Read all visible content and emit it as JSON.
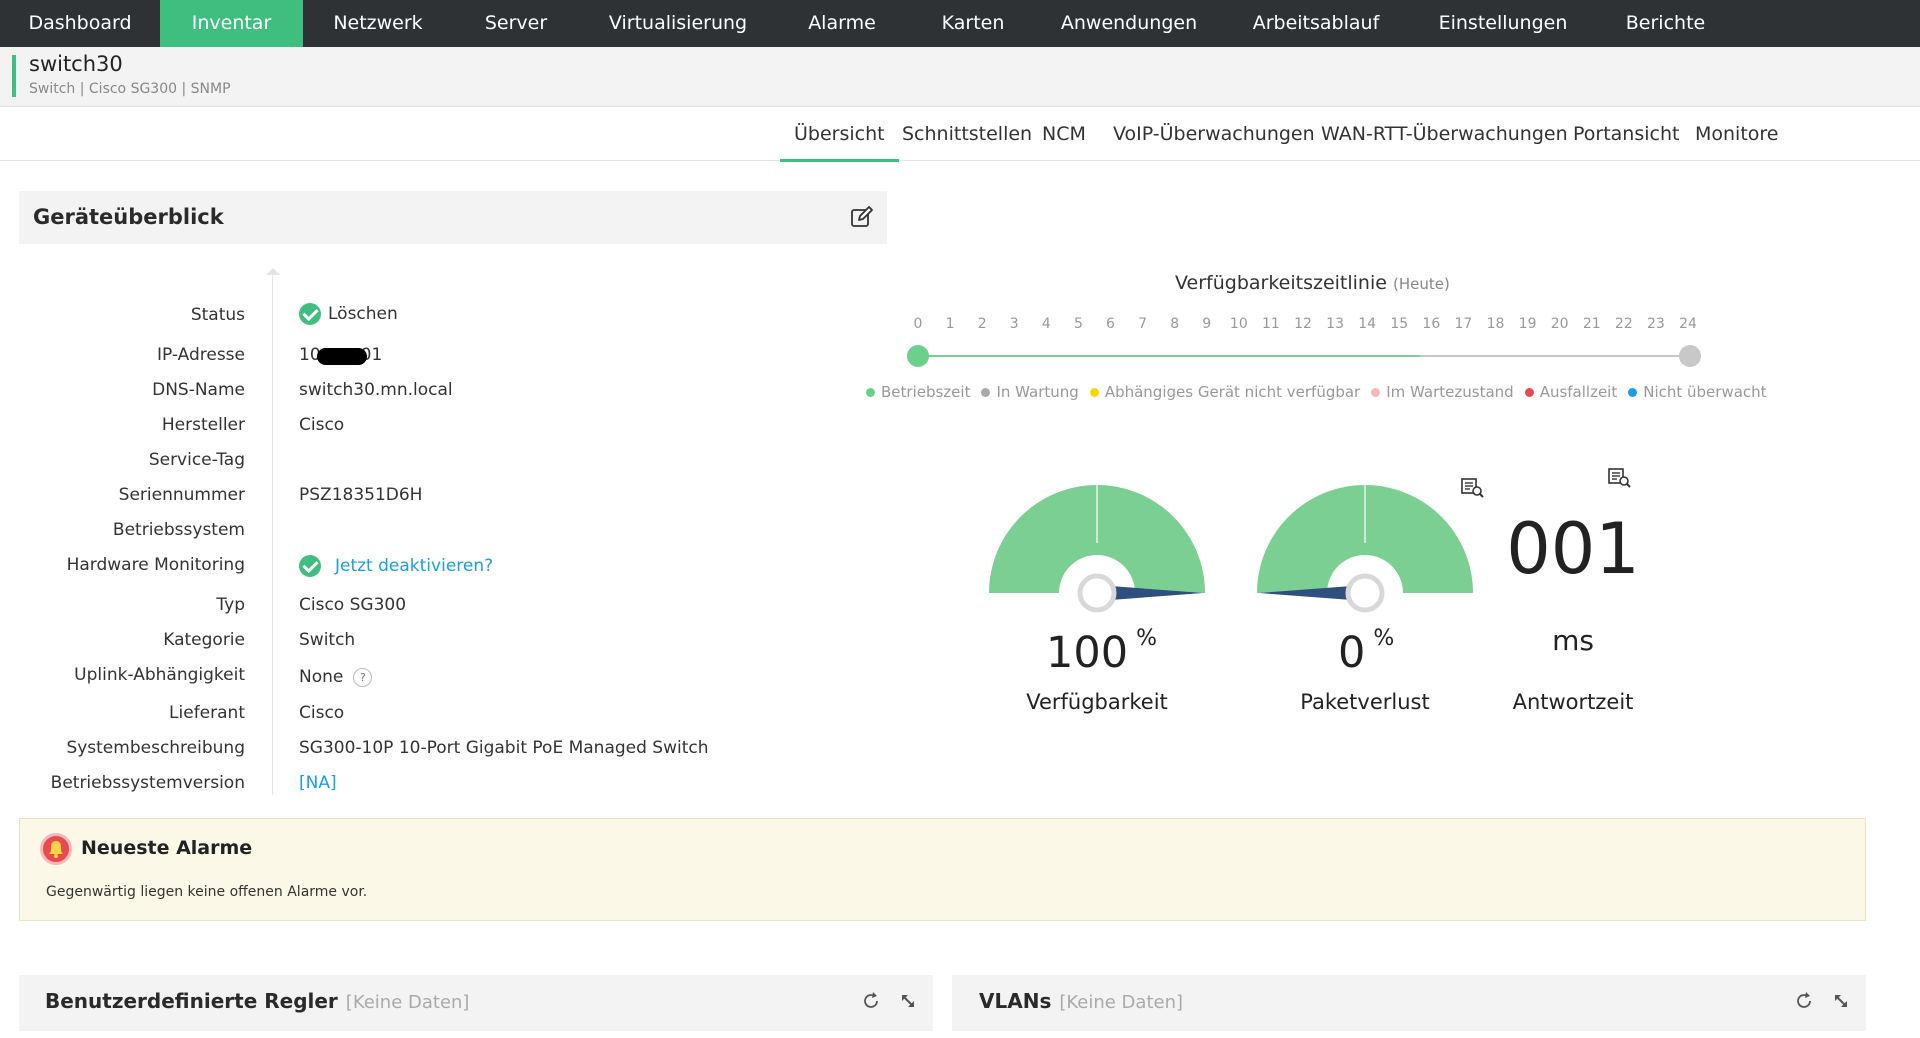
{
  "nav": {
    "items": [
      {
        "label": "Dashboard",
        "active": false
      },
      {
        "label": "Inventar",
        "active": true
      },
      {
        "label": "Netzwerk",
        "active": false
      },
      {
        "label": "Server",
        "active": false
      },
      {
        "label": "Virtualisierung",
        "active": false
      },
      {
        "label": "Alarme",
        "active": false
      },
      {
        "label": "Karten",
        "active": false
      },
      {
        "label": "Anwendungen",
        "active": false
      },
      {
        "label": "Arbeitsablauf",
        "active": false
      },
      {
        "label": "Einstellungen",
        "active": false
      },
      {
        "label": "Berichte",
        "active": false
      }
    ],
    "active_color": "#3fbf7f"
  },
  "device": {
    "name": "switch30",
    "meta": "Switch | Cisco SG300  | SNMP"
  },
  "tabs": [
    {
      "label": "Übersicht",
      "active": true
    },
    {
      "label": "Schnittstellen",
      "active": false
    },
    {
      "label": "NCM",
      "active": false
    },
    {
      "label": "VoIP-Überwachungen",
      "active": false
    },
    {
      "label": "WAN-RTT-Überwachungen",
      "active": false
    },
    {
      "label": "Portansicht",
      "active": false
    },
    {
      "label": "Monitore",
      "active": false
    }
  ],
  "overview": {
    "title": "Geräteüberblick",
    "edit_icon": "edit-icon",
    "properties": {
      "status": {
        "label": "Status",
        "value": "Löschen"
      },
      "ip": {
        "label": "IP-Adresse",
        "value_start": "10",
        "value_end": "01"
      },
      "dns": {
        "label": "DNS-Name",
        "value": "switch30.mn.local"
      },
      "manufacturer": {
        "label": "Hersteller",
        "value": "Cisco"
      },
      "service_tag": {
        "label": "Service-Tag",
        "value": ""
      },
      "serial": {
        "label": "Seriennummer",
        "value": "PSZ18351D6H"
      },
      "os": {
        "label": "Betriebssystem",
        "value": ""
      },
      "hardware_monitoring": {
        "label": "Hardware  Monitoring",
        "link": "Jetzt deaktivieren?"
      },
      "type": {
        "label": "Typ",
        "value": "Cisco SG300"
      },
      "category": {
        "label": "Kategorie",
        "value": "Switch"
      },
      "uplink": {
        "label": "Uplink-Abhängigkeit",
        "value": "None",
        "help": "?"
      },
      "vendor": {
        "label": "Lieferant",
        "value": "Cisco"
      },
      "sysdesc": {
        "label": "Systembeschreibung",
        "value": "SG300-10P 10-Port Gigabit PoE Managed Switch"
      },
      "osversion": {
        "label": "Betriebssystemversion",
        "link": "[NA]"
      }
    }
  },
  "timeline": {
    "title": "Verfügbarkeitszeitlinie",
    "subtitle": "(Heute)",
    "hours": [
      "0",
      "1",
      "2",
      "3",
      "4",
      "5",
      "6",
      "7",
      "8",
      "9",
      "10",
      "11",
      "12",
      "13",
      "14",
      "15",
      "16",
      "17",
      "18",
      "19",
      "20",
      "21",
      "22",
      "23",
      "24"
    ],
    "elapsed_fraction": 0.65,
    "legend": [
      {
        "label": "Betriebszeit",
        "color": "#6dd08a"
      },
      {
        "label": "In Wartung",
        "color": "#aaaaaa"
      },
      {
        "label": "Abhängiges Gerät nicht verfügbar",
        "color": "#f5d800"
      },
      {
        "label": "Im Wartezustand",
        "color": "#f7b6be"
      },
      {
        "label": "Ausfallzeit",
        "color": "#e84a4f"
      },
      {
        "label": "Nicht überwacht",
        "color": "#1a9ee5"
      }
    ]
  },
  "metrics": {
    "availability": {
      "value": "100",
      "unit": "%",
      "label": "Verfügbarkeit",
      "percent": 100
    },
    "packet_loss": {
      "value": "0",
      "unit": "%",
      "label": "Paketverlust",
      "percent": 0
    },
    "response": {
      "value": "001",
      "unit": "ms",
      "label": "Antwortzeit"
    },
    "gauge_color": "#7ccf93",
    "needle_color": "#2f4f7f",
    "report_icon": "report-icon"
  },
  "alarms": {
    "title": "Neueste Alarme",
    "message": "Gegenwärtig liegen keine offenen Alarme vor.",
    "icon": "bell-icon"
  },
  "bottom": {
    "custom": {
      "title": "Benutzerdefinierte Regler",
      "nodata": "[Keine Daten]"
    },
    "vlans": {
      "title": "VLANs",
      "nodata": "[Keine Daten]"
    },
    "refresh_icon": "refresh-icon",
    "collapse_icon": "collapse-icon"
  }
}
